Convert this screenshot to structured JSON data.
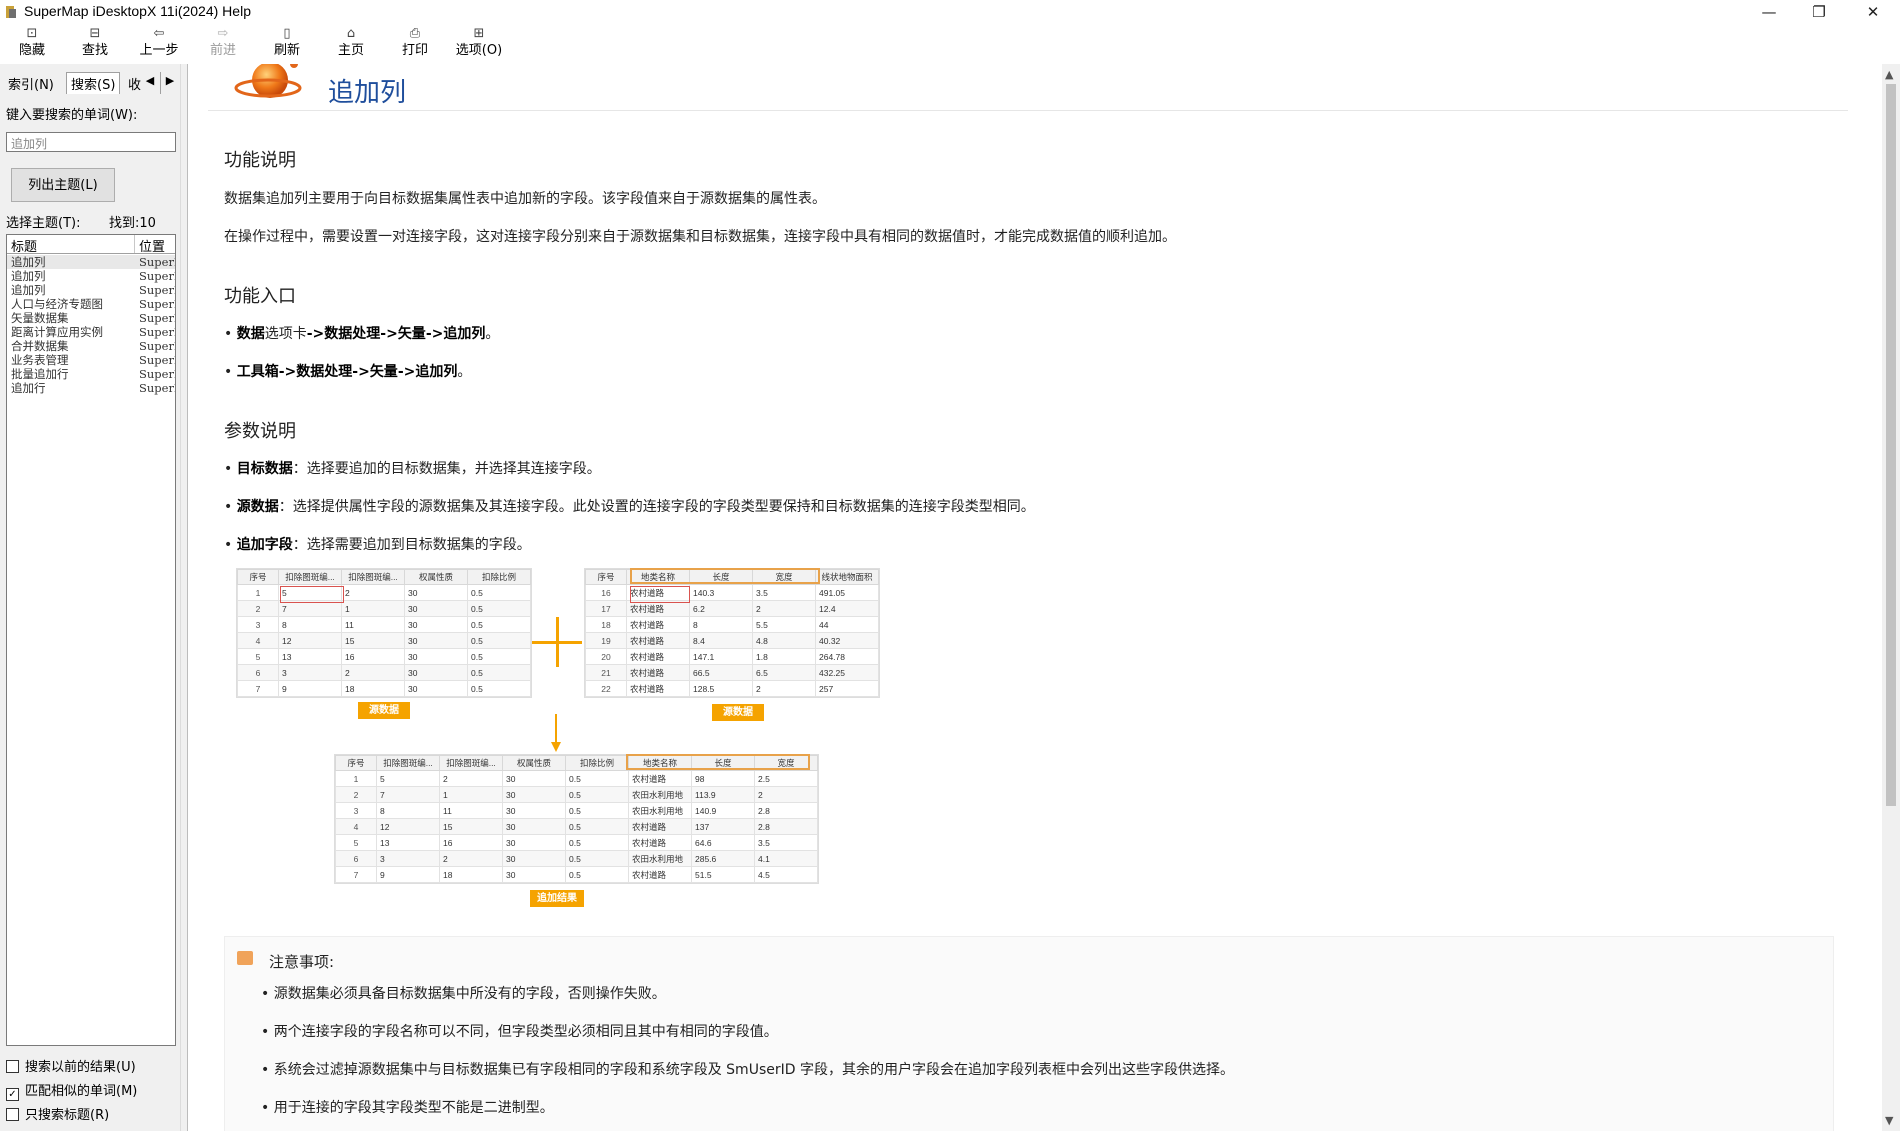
{
  "window": {
    "title": "SuperMap iDesktopX 11i(2024) Help",
    "minimize": "—",
    "restore": "❐",
    "close": "✕"
  },
  "toolbar": {
    "hide": {
      "label": "隐藏",
      "icon": "hide-icon"
    },
    "find": {
      "label": "查找",
      "icon": "find-icon"
    },
    "back": {
      "label": "上一步",
      "icon": "back-arrow-icon"
    },
    "forward": {
      "label": "前进",
      "icon": "forward-arrow-icon"
    },
    "refresh": {
      "label": "刷新",
      "icon": "refresh-icon"
    },
    "home": {
      "label": "主页",
      "icon": "home-icon"
    },
    "print": {
      "label": "打印",
      "icon": "print-icon"
    },
    "options": {
      "label": "选项(O)",
      "icon": "options-icon"
    }
  },
  "left": {
    "tabs": {
      "index": "索引(N)",
      "search": "搜索(S)",
      "favorites": "收"
    },
    "keyword_label": "键入要搜索的单词(W):",
    "keyword_value": "追加列",
    "list_topics_button": "列出主题(L)",
    "select_topic_label": "选择主题(T):",
    "found_label": "找到:10",
    "columns": {
      "title": "标题",
      "location": "位置"
    },
    "results": [
      {
        "title": "追加列",
        "location": "SuperMap"
      },
      {
        "title": "追加列",
        "location": "SuperMap"
      },
      {
        "title": "追加列",
        "location": "SuperMap"
      },
      {
        "title": "人口与经济专题图",
        "location": "SuperMap"
      },
      {
        "title": "矢量数据集",
        "location": "SuperMap"
      },
      {
        "title": "距离计算应用实例",
        "location": "SuperMap"
      },
      {
        "title": "合并数据集",
        "location": "SuperMap"
      },
      {
        "title": "业务表管理",
        "location": "SuperMap"
      },
      {
        "title": "批量追加行",
        "location": "SuperMap"
      },
      {
        "title": "追加行",
        "location": "SuperMap"
      }
    ],
    "checkboxes": {
      "search_prev": {
        "label": "搜索以前的结果(U)",
        "checked": false
      },
      "match_similar": {
        "label": "匹配相似的单词(M)",
        "checked": true
      },
      "titles_only": {
        "label": "只搜索标题(R)",
        "checked": false
      }
    }
  },
  "content": {
    "title": "追加列",
    "sections": {
      "desc_heading": "功能说明",
      "desc_p1": "数据集追加列主要用于向目标数据集属性表中追加新的字段。该字段值来自于源数据集的属性表。",
      "desc_p2": "在操作过程中，需要设置一对连接字段，这对连接字段分别来自于源数据集和目标数据集，连接字段中具有相同的数据值时，才能完成数据值的顺利追加。",
      "entry_heading": "功能入口",
      "entry1": {
        "b1": "数据",
        "t1": "选项卡",
        "sep1": "->",
        "b2": "数据处理",
        "sep2": "->",
        "b3": "矢量",
        "sep3": "->",
        "b4": "追加列",
        "end": "。"
      },
      "entry2": {
        "b1": "工具箱",
        "sep1": "->",
        "b2": "数据处理",
        "sep2": "->",
        "b3": "矢量",
        "sep3": "->",
        "b4": "追加列",
        "end": "。"
      },
      "params_heading": "参数说明",
      "param1": {
        "name": "目标数据",
        "text": "：选择要追加的目标数据集，并选择其连接字段。"
      },
      "param2": {
        "name": "源数据",
        "text": "：选择提供属性字段的源数据集及其连接字段。此处设置的连接字段的字段类型要保持和目标数据集的连接字段类型相同。"
      },
      "param3": {
        "name": "追加字段",
        "text": "：选择需要追加到目标数据集的字段。"
      }
    },
    "figure": {
      "left_tag": "源数据",
      "right_tag": "源数据",
      "result_tag": "追加结果",
      "left_table": {
        "headers": [
          "序号",
          "扣除图斑编...",
          "扣除图斑编...",
          "权属性质",
          "扣除比例"
        ],
        "rows": [
          [
            "1",
            "5",
            "2",
            "30",
            "0.5"
          ],
          [
            "2",
            "7",
            "1",
            "30",
            "0.5"
          ],
          [
            "3",
            "8",
            "11",
            "30",
            "0.5"
          ],
          [
            "4",
            "12",
            "15",
            "30",
            "0.5"
          ],
          [
            "5",
            "13",
            "16",
            "30",
            "0.5"
          ],
          [
            "6",
            "3",
            "2",
            "30",
            "0.5"
          ],
          [
            "7",
            "9",
            "18",
            "30",
            "0.5"
          ]
        ]
      },
      "right_table": {
        "headers": [
          "序号",
          "地类名称",
          "长度",
          "宽度",
          "线状地物面积"
        ],
        "rows": [
          [
            "16",
            "农村道路",
            "140.3",
            "3.5",
            "491.05"
          ],
          [
            "17",
            "农村道路",
            "6.2",
            "2",
            "12.4"
          ],
          [
            "18",
            "农村道路",
            "8",
            "5.5",
            "44"
          ],
          [
            "19",
            "农村道路",
            "8.4",
            "4.8",
            "40.32"
          ],
          [
            "20",
            "农村道路",
            "147.1",
            "1.8",
            "264.78"
          ],
          [
            "21",
            "农村道路",
            "66.5",
            "6.5",
            "432.25"
          ],
          [
            "22",
            "农村道路",
            "128.5",
            "2",
            "257"
          ]
        ]
      },
      "result_table": {
        "headers": [
          "序号",
          "扣除图斑编...",
          "扣除图斑编...",
          "权属性质",
          "扣除比例",
          "地类名称",
          "长度",
          "宽度"
        ],
        "rows": [
          [
            "1",
            "5",
            "2",
            "30",
            "0.5",
            "农村道路",
            "98",
            "2.5"
          ],
          [
            "2",
            "7",
            "1",
            "30",
            "0.5",
            "农田水利用地",
            "113.9",
            "2"
          ],
          [
            "3",
            "8",
            "11",
            "30",
            "0.5",
            "农田水利用地",
            "140.9",
            "2.8"
          ],
          [
            "4",
            "12",
            "15",
            "30",
            "0.5",
            "农村道路",
            "137",
            "2.8"
          ],
          [
            "5",
            "13",
            "16",
            "30",
            "0.5",
            "农村道路",
            "64.6",
            "3.5"
          ],
          [
            "6",
            "3",
            "2",
            "30",
            "0.5",
            "农田水利用地",
            "285.6",
            "4.1"
          ],
          [
            "7",
            "9",
            "18",
            "30",
            "0.5",
            "农村道路",
            "51.5",
            "4.5"
          ]
        ]
      }
    },
    "note": {
      "heading": "注意事项:",
      "items": [
        "源数据集必须具备目标数据集中所没有的字段，否则操作失败。",
        "两个连接字段的字段名称可以不同，但字段类型必须相同且其中有相同的字段值。",
        "系统会过滤掉源数据集中与目标数据集已有字段相同的字段和系统字段及 SmUserID 字段，其余的用户字段会在追加字段列表框中会列出这些字段供选择。",
        "用于连接的字段其字段类型不能是二进制型。"
      ]
    }
  },
  "colors": {
    "title_blue": "#1f4e9c",
    "tag_orange": "#f5a300",
    "highlight_orange": "#e8a24a"
  }
}
